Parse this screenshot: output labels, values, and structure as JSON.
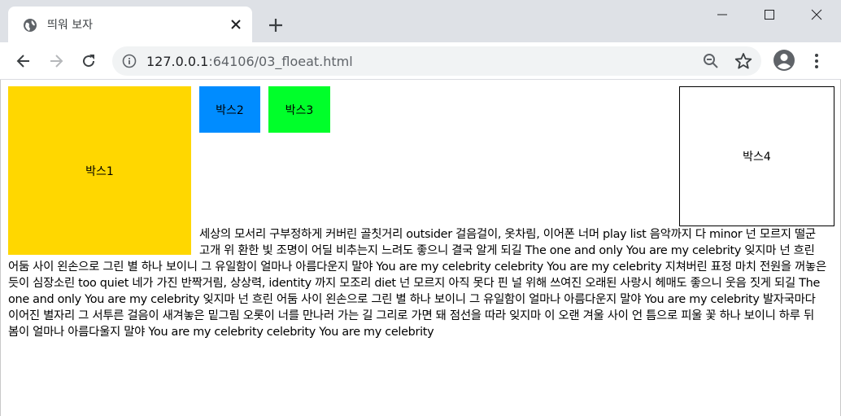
{
  "browser": {
    "tab": {
      "title": "띄워 보자"
    },
    "address": {
      "host": "127.0.0.1",
      "port_path": ":64106/03_floeat.html"
    }
  },
  "page": {
    "boxes": {
      "box1": "박스1",
      "box2": "박스2",
      "box3": "박스3",
      "box4": "박스4"
    },
    "paragraph": "세상의 모서리 구부정하게 커버린 골칫거리 outsider 걸음걸이, 옷차림, 이어폰 너머 play list 음악까지 다 minor 넌 모르지 떨군 고개 위 환한 빛 조명이 어딜 비추는지 느려도 좋으니 결국 알게 되길 The one and only You are my celebrity 잊지마 넌 흐린 어둠 사이 왼손으로 그린 별 하나 보이니 그 유일함이 얼마나 아름다운지 말야 You are my celebrity celebrity You are my celebrity 지쳐버린 표정 마치 전원을 꺼놓은 듯이 심장소린 too quiet 네가 가진 반짝거림, 상상력, identity 까지 모조리 diet 넌 모르지 아직 못다 핀 널 위해 쓰여진 오래된 사랑시 헤매도 좋으니 웃음 짓게 되길 The one and only You are my celebrity 잊지마 넌 흐린 어둠 사이 왼손으로 그린 별 하나 보이니 그 유일함이 얼마나 아름다운지 말야 You are my celebrity 발자국마다 이어진 별자리 그 서투른 걸음이 새겨놓은 밑그림 오롯이 너를 만나러 가는 길 그리로 가면 돼 점선을 따라 잊지마 이 오랜 겨울 사이 언 틈으로 피울 꽃 하나 보이니 하루 뒤 봄이 얼마나 아름다울지 말야 You are my celebrity celebrity You are my celebrity"
  },
  "icons": {
    "favicon": "globe-icon",
    "tab_close": "close-icon",
    "new_tab": "plus-icon",
    "minimize": "minimize-icon",
    "maximize": "maximize-icon",
    "window_close": "close-icon",
    "back": "arrow-left-icon",
    "forward": "arrow-right-icon",
    "reload": "reload-icon",
    "site_info": "info-icon",
    "zoom": "zoom-out-icon",
    "bookmark": "star-icon",
    "profile": "avatar-icon",
    "menu": "kebab-menu-icon"
  },
  "colors": {
    "box1": "#ffd700",
    "box2": "#008cff",
    "box3": "#00ff2a",
    "box4": "#ffffff"
  }
}
